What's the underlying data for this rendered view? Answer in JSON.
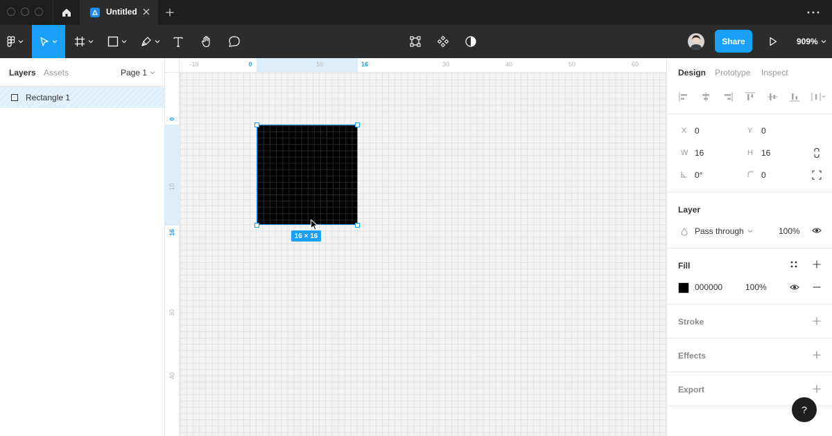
{
  "titlebar": {
    "tab_title": "Untitled",
    "icons": [
      "home-icon",
      "close-icon",
      "plus-icon",
      "more-icon"
    ]
  },
  "toolbar": {
    "tools": [
      "figma-menu-icon",
      "move-icon",
      "frame-icon",
      "rectangle-icon",
      "pen-icon",
      "text-icon",
      "hand-icon",
      "comment-icon"
    ],
    "center_tools": [
      "edit-object-icon",
      "component-icon",
      "mask-icon"
    ],
    "share_label": "Share",
    "zoom": "909%",
    "accent": "#18a0fb"
  },
  "left_panel": {
    "tabs": [
      "Layers",
      "Assets"
    ],
    "page": "Page 1",
    "layers": [
      {
        "name": "Rectangle 1",
        "type": "rectangle",
        "selected": true
      }
    ]
  },
  "canvas": {
    "ruler_x": [
      "-10",
      "0",
      "10",
      "16",
      "30",
      "40",
      "50",
      "60"
    ],
    "ruler_y": [
      "0",
      "10",
      "16",
      "30",
      "40"
    ],
    "selection": {
      "size_label": "16 × 16",
      "fill": "#000000"
    }
  },
  "right_panel": {
    "tabs": [
      "Design",
      "Prototype",
      "Inspect"
    ],
    "x_label": "X",
    "x": "0",
    "y_label": "Y",
    "y": "0",
    "w_label": "W",
    "w": "16",
    "h_label": "H",
    "h": "16",
    "rotation": "0°",
    "radius": "0",
    "layer_title": "Layer",
    "blend_mode": "Pass through",
    "layer_opacity": "100%",
    "fill_title": "Fill",
    "fill_hex": "000000",
    "fill_opacity": "100%",
    "stroke_title": "Stroke",
    "effects_title": "Effects",
    "export_title": "Export",
    "help": "?"
  }
}
